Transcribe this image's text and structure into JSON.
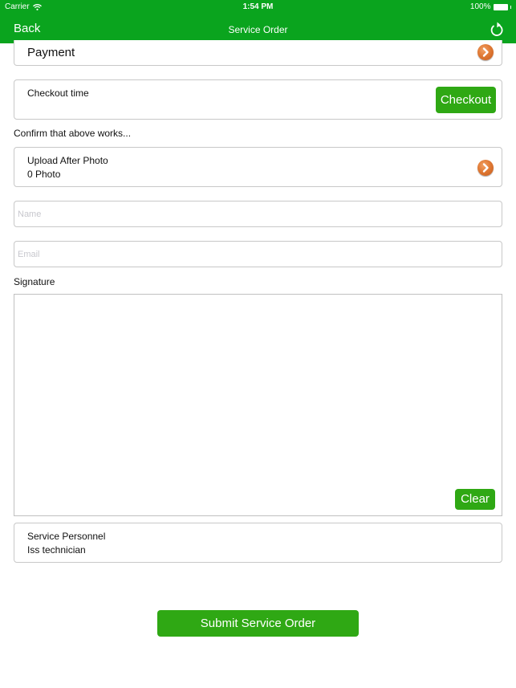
{
  "status_bar": {
    "carrier": "Carrier",
    "time": "1:54 PM",
    "battery": "100%"
  },
  "nav": {
    "back_label": "Back",
    "title": "Service Order",
    "refresh_icon": "refresh-icon"
  },
  "payment": {
    "label": "Payment",
    "icon": "chevron-right-circle-icon"
  },
  "checkout": {
    "label": "Checkout time",
    "button_label": "Checkout"
  },
  "confirm_text": "Confirm that above works...",
  "upload": {
    "title": "Upload After Photo",
    "count": "0 Photo",
    "icon": "chevron-right-circle-icon"
  },
  "form": {
    "name_placeholder": "Name",
    "name_value": "",
    "email_placeholder": "Email",
    "email_value": ""
  },
  "signature": {
    "label": "Signature",
    "clear_label": "Clear"
  },
  "personnel": {
    "title": "Service Personnel",
    "value": "Iss technician"
  },
  "submit_label": "Submit Service Order",
  "colors": {
    "brand_green": "#0aa41e",
    "button_green": "#2fa814",
    "chevron_orange": "#e07a35"
  }
}
